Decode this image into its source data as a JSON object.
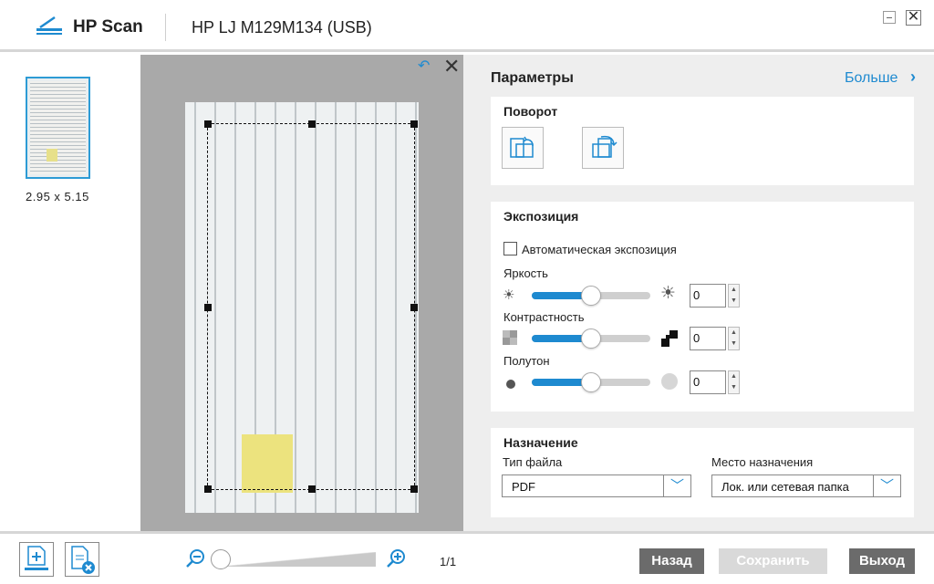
{
  "header": {
    "app_title": "HP Scan",
    "device": "HP LJ M129M134 (USB)",
    "minimize_icon": "minimize-icon",
    "close_icon": "close-icon"
  },
  "thumbnails": {
    "items": [
      {
        "size": "2.95 x 5.15"
      }
    ]
  },
  "preview": {
    "rotate_icon": "undo-rotate-icon",
    "close_icon": "close-icon"
  },
  "settings": {
    "title": "Параметры",
    "more_label": "Больше",
    "rotation": {
      "title": "Поворот"
    },
    "exposure": {
      "title": "Экспозиция",
      "auto_label": "Автоматическая экспозиция",
      "auto_checked": false,
      "brightness": {
        "label": "Яркость",
        "value": "0",
        "level": 0.5
      },
      "contrast": {
        "label": "Контрастность",
        "value": "0",
        "level": 0.5
      },
      "halftone": {
        "label": "Полутон",
        "value": "0",
        "level": 0.5
      }
    },
    "destination": {
      "title": "Назначение",
      "file_type_label": "Тип файла",
      "file_type_value": "PDF",
      "dest_label": "Место назначения",
      "dest_value": "Лок. или сетевая папка"
    }
  },
  "footer": {
    "page_count": "1/1",
    "back_label": "Назад",
    "save_label": "Сохранить",
    "exit_label": "Выход"
  },
  "colors": {
    "accent": "#1e8ad0",
    "button_dark": "#6b6b6b",
    "button_disabled": "#d9d9d9"
  }
}
